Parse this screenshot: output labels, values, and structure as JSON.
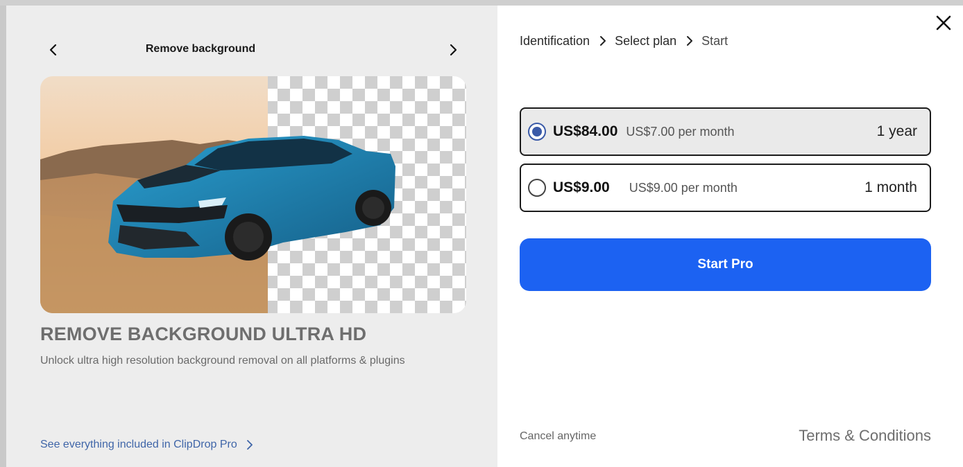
{
  "left": {
    "feature_title": "Remove background",
    "headline": "REMOVE BACKGROUND ULTRA HD",
    "subline": "Unlock ultra high resolution background removal on all platforms & plugins",
    "see_all_link": "See everything included in ClipDrop Pro"
  },
  "breadcrumb": {
    "step1": "Identification",
    "step2": "Select plan",
    "step3": "Start"
  },
  "plans": [
    {
      "price": "US$84.00",
      "per_month": "US$7.00 per month",
      "period": "1 year",
      "selected": true
    },
    {
      "price": "US$9.00",
      "per_month": "US$9.00 per month",
      "period": "1 month",
      "selected": false
    }
  ],
  "cta_label": "Start Pro",
  "footer": {
    "cancel_text": "Cancel anytime",
    "terms_link": "Terms & Conditions"
  },
  "colors": {
    "accent": "#1c62f2",
    "radio_selected": "#3a5aa8",
    "link": "#3f65a8"
  },
  "icons": [
    "chevron-left-icon",
    "chevron-right-icon",
    "close-icon",
    "breadcrumb-chevron-icon"
  ]
}
